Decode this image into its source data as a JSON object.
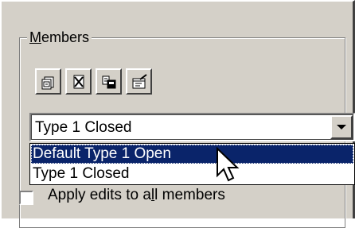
{
  "group": {
    "label_mnemonic": "M",
    "label_rest": "embers"
  },
  "toolbar": [
    {
      "icon": "new-member-icon"
    },
    {
      "icon": "delete-member-icon"
    },
    {
      "icon": "copy-member-icon"
    },
    {
      "icon": "member-properties-icon"
    }
  ],
  "combo": {
    "value": "Type 1 Closed"
  },
  "dropdown": {
    "items": [
      "Default Type 1 Open",
      "Type 1 Closed"
    ],
    "highlighted_index": 0
  },
  "checkbox": {
    "label_before": "Apply edits to a",
    "label_mnemonic": "l",
    "label_after": "l members",
    "checked": false
  },
  "colors": {
    "face": "#d4d0c8",
    "highlight": "#0a246a"
  }
}
